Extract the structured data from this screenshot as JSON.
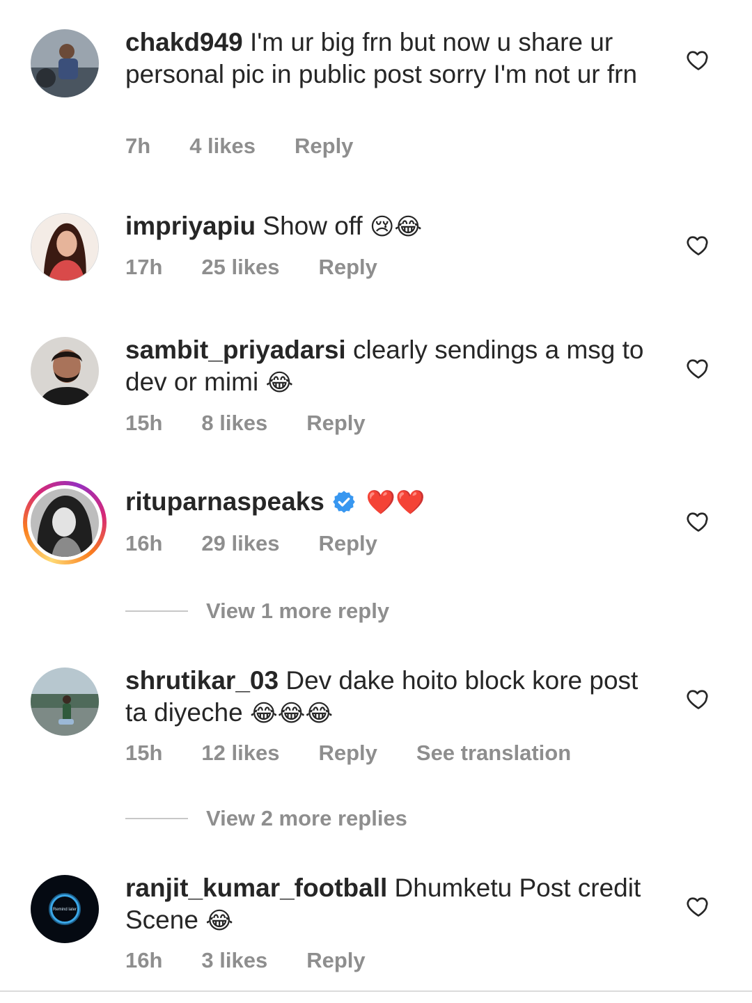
{
  "comments": [
    {
      "username": "chakd949",
      "text": "I'm ur big frn but now u share ur personal pic in public post sorry I'm not ur frn",
      "emoji": "",
      "time": "7h",
      "likes": "4 likes",
      "reply": "Reply",
      "heart_icon": "heart-outline-icon"
    },
    {
      "username": "impriyapiu",
      "text": "Show off",
      "emoji": "😢😂",
      "time": "17h",
      "likes": "25 likes",
      "reply": "Reply",
      "heart_icon": "heart-outline-icon"
    },
    {
      "username": "sambit_priyadarsi",
      "text": "clearly sendings a msg to dev or mimi",
      "emoji": "😂",
      "time": "15h",
      "likes": "8 likes",
      "reply": "Reply",
      "heart_icon": "heart-outline-icon"
    },
    {
      "username": "rituparnaspeaks",
      "verified": true,
      "text": "",
      "emoji": "❤️❤️",
      "time": "16h",
      "likes": "29 likes",
      "reply": "Reply",
      "view_more": "View 1 more reply",
      "heart_icon": "heart-outline-icon"
    },
    {
      "username": "shrutikar_03",
      "text": "Dev dake hoito block kore post ta diyeche",
      "emoji": "😂😂😂",
      "time": "15h",
      "likes": "12 likes",
      "reply": "Reply",
      "translation": "See translation",
      "view_more": "View 2 more replies",
      "heart_icon": "heart-outline-icon"
    },
    {
      "username": "ranjit_kumar_football",
      "text": "Dhumketu Post credit Scene",
      "emoji": "😂",
      "time": "16h",
      "likes": "3 likes",
      "reply": "Reply",
      "avatar_text": "Remind later",
      "heart_icon": "heart-outline-icon"
    }
  ],
  "colors": {
    "text": "#262626",
    "secondary": "#8e8e8e",
    "verified": "#3897f0",
    "story_ring": [
      "#feda75",
      "#fa7e1e",
      "#d62976",
      "#962fbf"
    ]
  }
}
